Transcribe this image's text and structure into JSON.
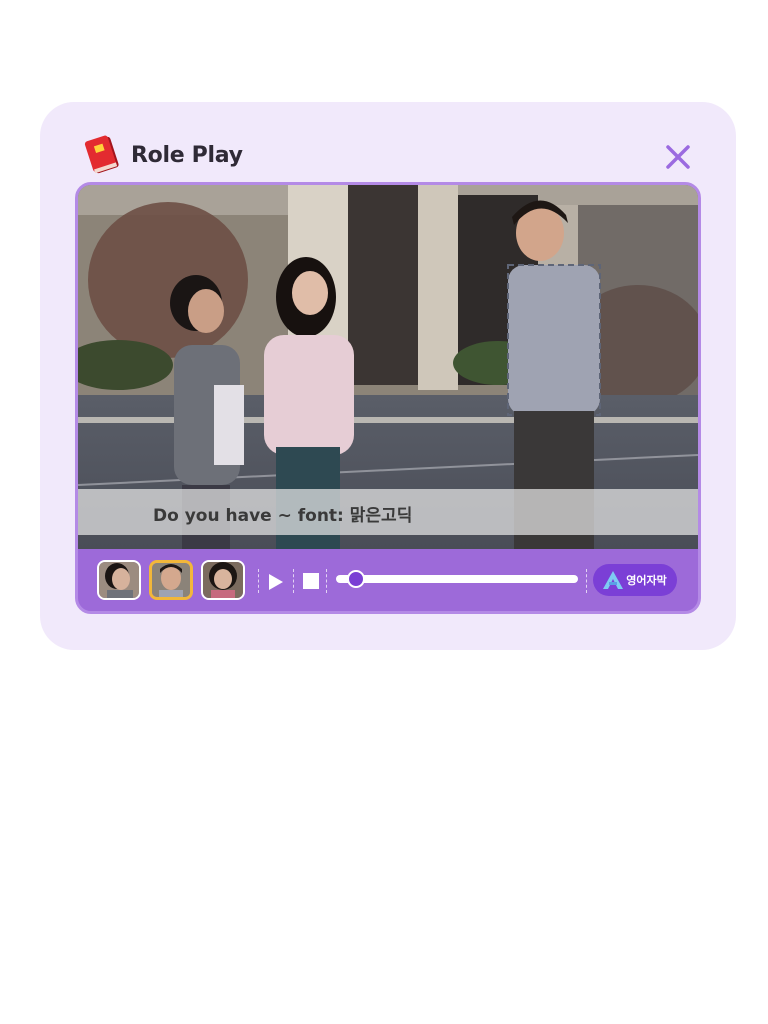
{
  "header": {
    "title": "Role Play",
    "icon": "book-icon",
    "close_icon": "close-icon"
  },
  "video": {
    "subtitle": "Do you have ~ font: 맑은고딕"
  },
  "controls": {
    "characters": [
      {
        "name": "character-girl-ponytail",
        "selected": false
      },
      {
        "name": "character-man",
        "selected": true
      },
      {
        "name": "character-girl-short-hair",
        "selected": false
      }
    ],
    "play_icon": "play-icon",
    "stop_icon": "stop-icon",
    "progress": 0.05,
    "subtitle_button_label": "영어자막",
    "subtitle_button_icon": "letter-a-icon"
  },
  "colors": {
    "panel_background": "#f1e9fb",
    "player_purple": "#9d6ad9",
    "accent_purple": "#7b3fd6",
    "selected_border": "#f2b73a",
    "close_icon": "#9b6ae0"
  }
}
